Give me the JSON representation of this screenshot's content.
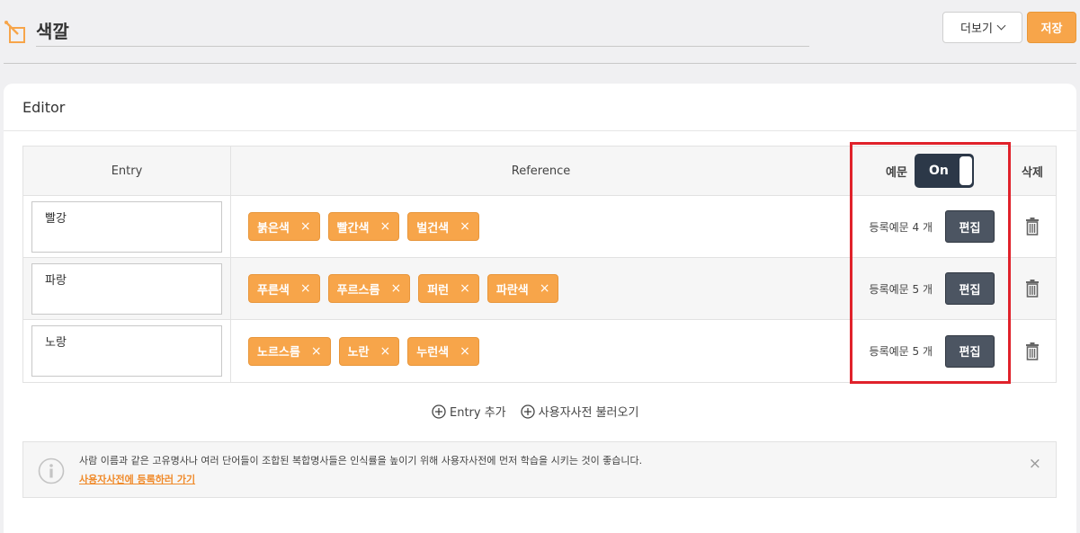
{
  "header": {
    "title": "색깔",
    "more_label": "더보기",
    "save_label": "저장"
  },
  "card": {
    "title": "Editor"
  },
  "table": {
    "headers": {
      "entry": "Entry",
      "reference": "Reference",
      "example": "예문",
      "delete": "삭제"
    },
    "toggle_label": "On",
    "rows": [
      {
        "entry": "빨강",
        "tags": [
          "붉은색",
          "빨간색",
          "벌건색"
        ],
        "example_count": "등록예문 4 개",
        "edit_label": "편집"
      },
      {
        "entry": "파랑",
        "tags": [
          "푸른색",
          "푸르스름",
          "퍼런",
          "파란색"
        ],
        "example_count": "등록예문 5 개",
        "edit_label": "편집"
      },
      {
        "entry": "노랑",
        "tags": [
          "노르스름",
          "노란",
          "누런색"
        ],
        "example_count": "등록예문 5 개",
        "edit_label": "편집"
      }
    ]
  },
  "actions": {
    "add_entry": "Entry 추가",
    "load_dictionary": "사용자사전 불러오기"
  },
  "notice": {
    "text": "사람 이름과 같은 고유명사나 여러 단어들이 조합된 복합명사들은 인식률을 높이기 위해 사용자사전에 먼저 학습을 시키는 것이 좋습니다.",
    "link": "사용자사전에 등록하러 가기",
    "close": "×"
  },
  "icons": {
    "tag_remove": "×",
    "header": "edit-square-icon",
    "trash": "trash-icon",
    "info": "info-circle-icon"
  },
  "colors": {
    "accent": "#f7a54a",
    "dark": "#2c3848",
    "highlight": "#e0222b"
  }
}
